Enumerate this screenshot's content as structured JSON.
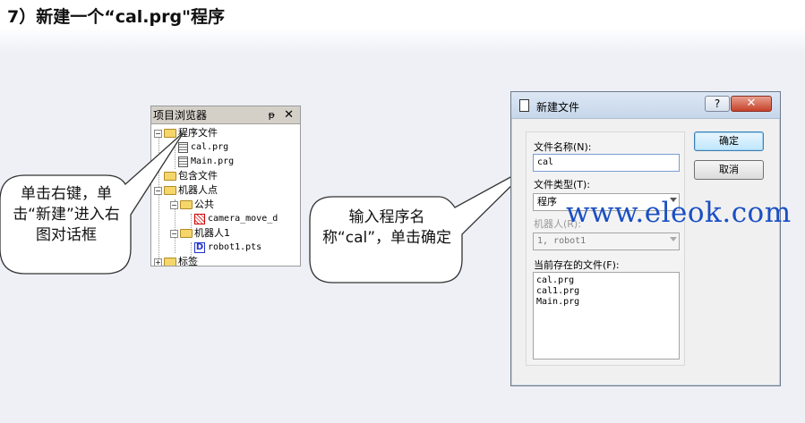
{
  "slide": {
    "title": "7）新建一个“cal.prg\"程序"
  },
  "browser": {
    "title": "项目浏览器",
    "pin": "ᵽ",
    "close": "✕",
    "items": [
      {
        "label": "程序文件",
        "expander": "−"
      },
      {
        "label": "cal.prg"
      },
      {
        "label": "Main.prg"
      },
      {
        "label": "包含文件",
        "expander": ""
      },
      {
        "label": "机器人点",
        "expander": "−"
      },
      {
        "label": "公共",
        "expander": "−"
      },
      {
        "label": "camera_move_d"
      },
      {
        "label": "机器人1",
        "expander": "−"
      },
      {
        "label": "robot1.pts"
      },
      {
        "label": "标签",
        "expander": "+"
      }
    ]
  },
  "callouts": {
    "left": "单击右键，单击“新建”进入右图对话框",
    "right": "输入程序名称“cal”，单击确定"
  },
  "dialog": {
    "title": "新建文件",
    "help": "?",
    "close": "✕",
    "filename_label": "文件名称(N):",
    "filename_value": "cal",
    "filetype_label": "文件类型(T):",
    "filetype_value": "程序",
    "robot_label": "机器人(R):",
    "robot_value": "1, robot1",
    "existing_label": "当前存在的文件(F):",
    "existing_files": [
      "cal.prg",
      "cal1.prg",
      "Main.prg"
    ],
    "ok_label": "确定",
    "cancel_label": "取消"
  },
  "watermark": "www.eleok.com"
}
